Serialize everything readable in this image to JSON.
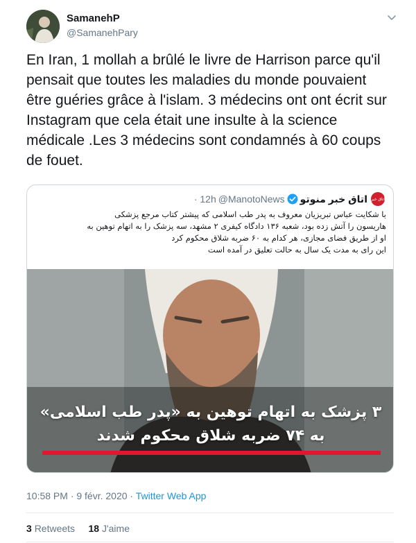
{
  "author": {
    "name": "SamanehP",
    "handle": "@SamanehPary"
  },
  "tweet": {
    "text": "En Iran, 1 mollah a brûlé le livre de Harrison parce qu'il pensait que toutes les maladies du monde pouvaient être guéries grâce à l'islam. 3 médecins ont ont écrit sur Instagram que cela était une insulte à la science médicale .Les 3 médecins sont condamnés à 60 coups de fouet.",
    "timestamp": "10:58 PM · 9 févr. 2020",
    "source_sep": " · ",
    "source": "Twitter Web App"
  },
  "quoted": {
    "name": "اتاق خبر منوتو",
    "logo_text": "اتاق خبر",
    "handle": "@ManotoNews",
    "time": "· 12h",
    "lines": [
      "با شکایت عباس تبریزیان معروف به پدر طب اسلامی که پیشتر کتاب مرجع پزشکی",
      "هاریسون را آتش زده بود، شعبه ۱۳۶ دادگاه کیفری ۲ مشهد، سه پزشک را به اتهام توهین به",
      "او از طریق فضای مجازی، هر کدام به ۶۰ ضربه شلاق محکوم کرد",
      "این رای به مدت یک سال به حالت تعلیق در آمده است"
    ],
    "caption_line1": "۳ پزشک به اتهام توهین به «پدر طب اسلامی»",
    "caption_line2": "به ۷۴ ضربه شلاق محکوم شدند"
  },
  "stats": {
    "retweets_count": "3",
    "retweets_label": "Retweets",
    "likes_count": "18",
    "likes_label": "J'aime"
  },
  "colors": {
    "link": "#1b95e0",
    "muted": "#657786",
    "accent_red": "#e3162d"
  },
  "icons": [
    "chevron-down-icon",
    "verified-badge-icon"
  ]
}
